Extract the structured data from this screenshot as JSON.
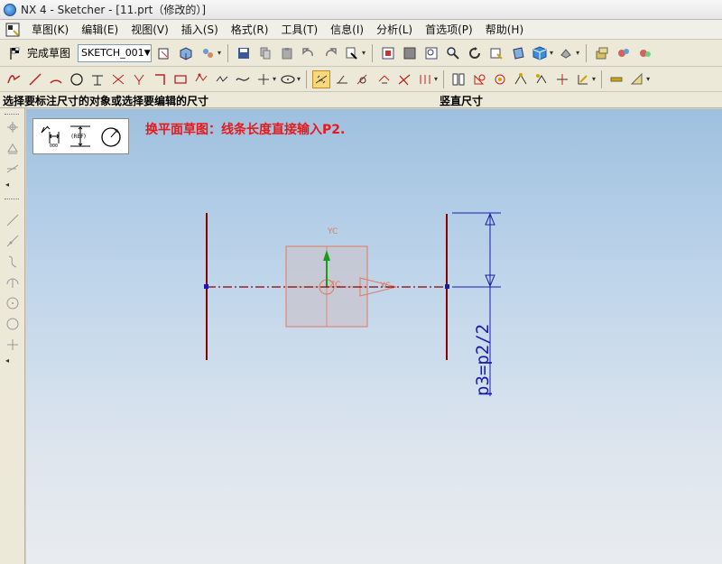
{
  "window": {
    "title": "NX 4 - Sketcher - [11.prt（修改的）]"
  },
  "menu": {
    "items": [
      "草图(K)",
      "编辑(E)",
      "视图(V)",
      "插入(S)",
      "格式(R)",
      "工具(T)",
      "信息(I)",
      "分析(L)",
      "首选项(P)",
      "帮助(H)"
    ]
  },
  "toolbar": {
    "finish_sketch_label": "完成草图",
    "sketch_name": "SKETCH_001"
  },
  "cue": {
    "prompt": "选择要标注尺寸的对象或选择要编辑的尺寸",
    "status": "竖直尺寸"
  },
  "canvas": {
    "annotation": "换平面草图：线条长度直接输入P2.",
    "dimension_label": "p3=p2/2",
    "axis_yc": "YC",
    "axis_xc": "XC",
    "axis_zc": "ZC",
    "palette_ref_label": "(REF)"
  },
  "colors": {
    "curve": "#8b0000",
    "dimension": "#1a1ab0",
    "datum": "#e07a5f",
    "annotation": "#e8191a"
  }
}
